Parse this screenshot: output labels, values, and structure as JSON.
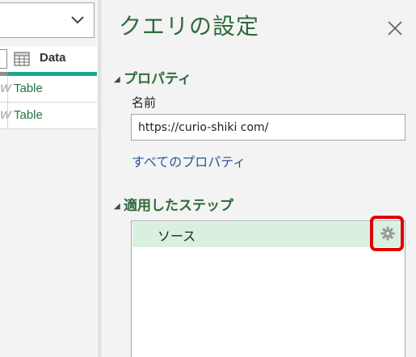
{
  "left_pane": {
    "column_header": "Data",
    "rows": [
      {
        "stub": "W",
        "value": "Table"
      },
      {
        "stub": "W",
        "value": "Table"
      }
    ],
    "accent_color": "#1aa98f"
  },
  "query_settings": {
    "title": "クエリの設定",
    "properties": {
      "heading": "プロパティ",
      "name_label": "名前",
      "name_value": "https://curio-shiki com/",
      "all_properties_link": "すべてのプロパティ"
    },
    "applied_steps": {
      "heading": "適用したステップ",
      "steps": [
        {
          "label": "ソース",
          "selected": true,
          "has_settings_gear": true
        }
      ]
    },
    "icons": {
      "close": "close-icon",
      "gear": "gear-icon",
      "collapse": "collapse-triangle-icon"
    },
    "colors": {
      "title": "#2f6a3d",
      "link": "#2b5797",
      "selected_step": "#d9f0e1",
      "highlight_border": "#e00000"
    }
  }
}
